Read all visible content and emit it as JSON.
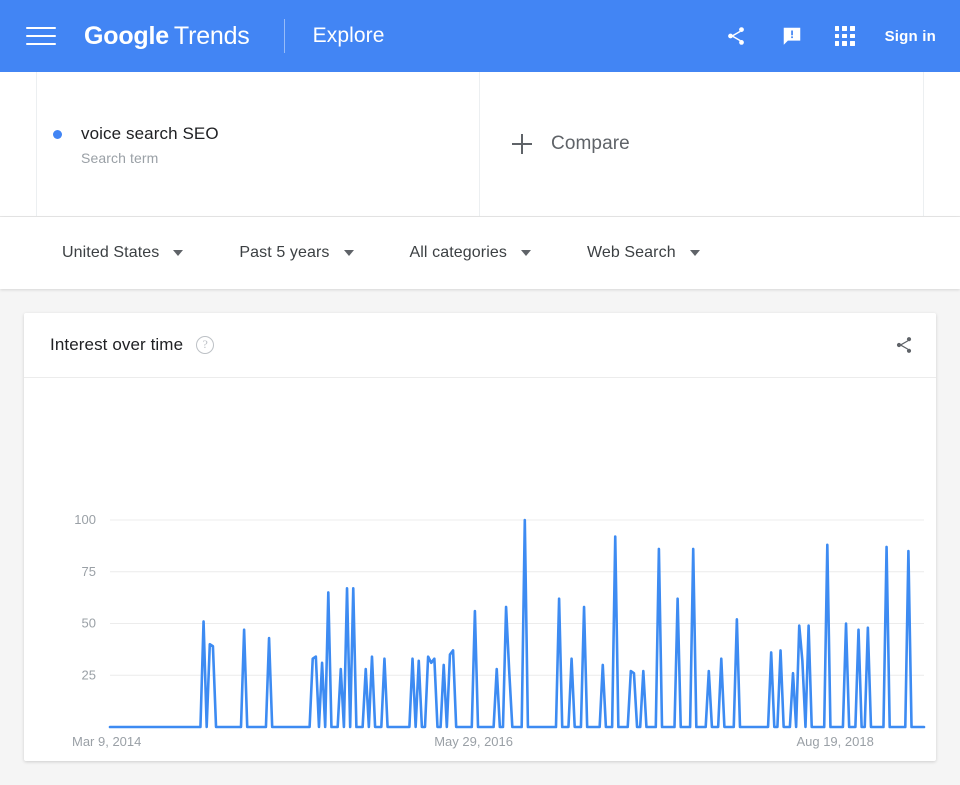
{
  "header": {
    "menu_icon": "hamburger-menu-icon",
    "brand_google": "Google",
    "brand_trends": "Trends",
    "explore_label": "Explore",
    "share_icon": "share-icon",
    "feedback_icon": "feedback-icon",
    "apps_icon": "apps-grid-icon",
    "signin_label": "Sign in",
    "background_color": "#4285f4"
  },
  "search_terms": {
    "items": [
      {
        "term": "voice search SEO",
        "type": "Search term",
        "dot_color": "#4285f4"
      }
    ],
    "compare_label": "Compare",
    "compare_plus_icon": "plus-icon"
  },
  "filters": [
    {
      "label": "United States",
      "name": "location-filter"
    },
    {
      "label": "Past 5 years",
      "name": "time-range-filter"
    },
    {
      "label": "All categories",
      "name": "category-filter"
    },
    {
      "label": "Web Search",
      "name": "search-type-filter"
    }
  ],
  "card": {
    "title": "Interest over time",
    "help_icon": "help-circle-icon",
    "help_glyph": "?",
    "share_icon": "share-icon"
  },
  "chart_data": {
    "type": "line",
    "title": "Interest over time",
    "xlabel": "",
    "ylabel": "",
    "ylim": [
      0,
      100
    ],
    "yticks": [
      100,
      75,
      50,
      25
    ],
    "ytick_labels": [
      "100",
      "75",
      "50",
      "25"
    ],
    "xtick_labels": [
      "Mar 9, 2014",
      "May 29, 2016",
      "Aug 19, 2018"
    ],
    "xtick_positions": [
      0,
      0.445,
      0.89
    ],
    "grid": true,
    "line_color": "#3d8bf2",
    "legend": null,
    "series": [
      {
        "name": "voice search SEO",
        "values": [
          0,
          0,
          0,
          0,
          0,
          0,
          0,
          0,
          0,
          0,
          0,
          0,
          0,
          0,
          0,
          0,
          0,
          0,
          0,
          0,
          0,
          0,
          0,
          0,
          0,
          0,
          0,
          0,
          0,
          0,
          51,
          0,
          40,
          39,
          0,
          0,
          0,
          0,
          0,
          0,
          0,
          0,
          0,
          47,
          0,
          0,
          0,
          0,
          0,
          0,
          0,
          43,
          0,
          0,
          0,
          0,
          0,
          0,
          0,
          0,
          0,
          0,
          0,
          0,
          0,
          33,
          34,
          0,
          31,
          0,
          65,
          0,
          0,
          0,
          28,
          0,
          67,
          0,
          67,
          0,
          0,
          0,
          28,
          0,
          34,
          0,
          0,
          0,
          33,
          0,
          0,
          0,
          0,
          0,
          0,
          0,
          0,
          33,
          0,
          32,
          0,
          0,
          34,
          31,
          33,
          0,
          0,
          30,
          0,
          35,
          37,
          0,
          0,
          0,
          0,
          0,
          0,
          56,
          0,
          0,
          0,
          0,
          0,
          0,
          28,
          0,
          0,
          58,
          27,
          0,
          0,
          0,
          0,
          100,
          0,
          0,
          0,
          0,
          0,
          0,
          0,
          0,
          0,
          0,
          62,
          0,
          0,
          0,
          33,
          0,
          0,
          0,
          58,
          0,
          0,
          0,
          0,
          0,
          30,
          0,
          0,
          0,
          92,
          0,
          0,
          0,
          0,
          27,
          26,
          0,
          0,
          27,
          0,
          0,
          0,
          0,
          86,
          0,
          0,
          0,
          0,
          0,
          62,
          0,
          0,
          0,
          0,
          86,
          0,
          0,
          0,
          0,
          27,
          0,
          0,
          0,
          33,
          0,
          0,
          0,
          0,
          52,
          0,
          0,
          0,
          0,
          0,
          0,
          0,
          0,
          0,
          0,
          36,
          0,
          0,
          37,
          0,
          0,
          0,
          26,
          0,
          49,
          32,
          0,
          49,
          0,
          0,
          0,
          0,
          0,
          88,
          0,
          0,
          0,
          0,
          0,
          50,
          0,
          0,
          0,
          47,
          0,
          0,
          48,
          0,
          0,
          0,
          0,
          0,
          87,
          0,
          0,
          0,
          0,
          0,
          0,
          85,
          0,
          0,
          0,
          0,
          0
        ]
      }
    ]
  }
}
